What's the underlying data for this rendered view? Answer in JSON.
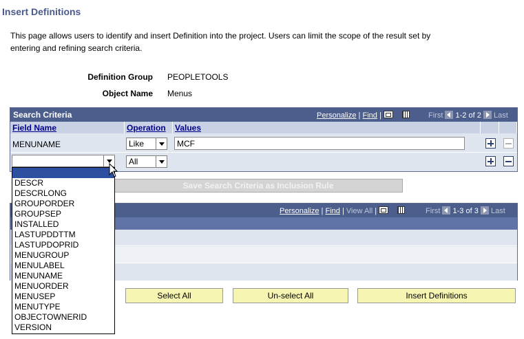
{
  "page": {
    "title": "Insert Definitions",
    "intro": "This page allows users to identify and insert Definition into the project. Users can limit the scope of the result set by entering and refining search criteria."
  },
  "fields": {
    "definition_group_label": "Definition Group",
    "definition_group_value": "PEOPLETOOLS",
    "object_name_label": "Object Name",
    "object_name_value": "Menus"
  },
  "search_grid": {
    "title": "Search Criteria",
    "personalize": "Personalize",
    "find": "Find",
    "first": "First",
    "range": "1-2 of 2",
    "last": "Last",
    "columns": [
      "Field Name",
      "Operation",
      "Values"
    ],
    "rows": [
      {
        "field": "MENUNAME",
        "operation": "Like",
        "value": "MCF"
      },
      {
        "field": "",
        "operation": "All",
        "value": ""
      }
    ]
  },
  "save_button": "Save Search Criteria as Inclusion Rule",
  "results_grid": {
    "personalize": "Personalize",
    "find": "Find",
    "view_all": "View All",
    "first": "First",
    "range": "1-3 of 3",
    "last": "Last"
  },
  "dropdown_options": [
    "",
    "DESCR",
    "DESCRLONG",
    "GROUPORDER",
    "GROUPSEP",
    "INSTALLED",
    "LASTUPDDTTM",
    "LASTUPDOPRID",
    "MENUGROUP",
    "MENULABEL",
    "MENUNAME",
    "MENUORDER",
    "MENUSEP",
    "MENUTYPE",
    "OBJECTOWNERID",
    "VERSION"
  ],
  "buttons": {
    "select_all": "Select All",
    "unselect_all": "Un-select All",
    "insert": "Insert Definitions"
  },
  "icons": [
    "zoom-icon",
    "grid-icon",
    "nav-left-icon",
    "nav-right-icon",
    "plus-icon",
    "minus-icon",
    "dropdown-arrow-icon",
    "mouse-cursor-icon"
  ],
  "colors": {
    "title": "#4a5a8c",
    "grid_header": "#4c5e8c",
    "button_yellow": "#f6f6b2",
    "selection": "#2d4fa0"
  }
}
